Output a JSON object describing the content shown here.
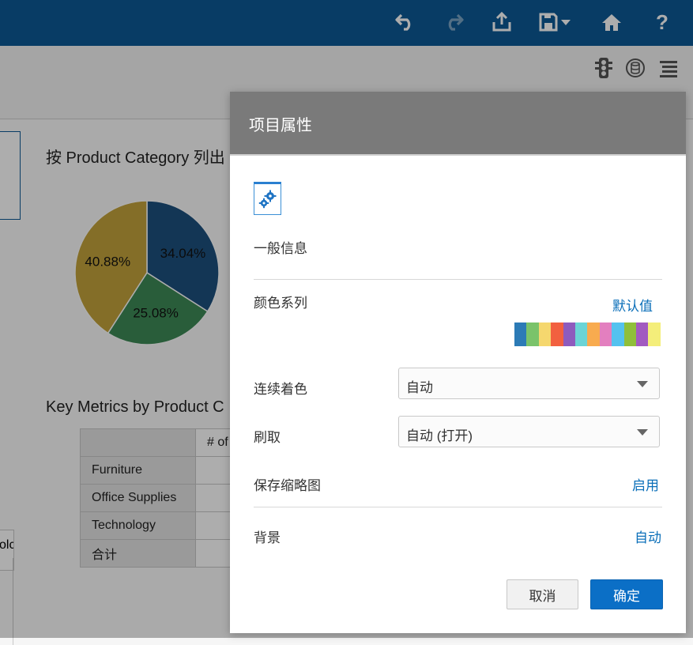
{
  "topbar": {
    "icons": [
      "undo-icon",
      "redo-icon",
      "export-icon",
      "save-icon",
      "dropdown-caret-icon",
      "home-icon",
      "help-icon"
    ],
    "help_label": "?",
    "bg_color": "#0c5996"
  },
  "toolbar": {
    "icons": [
      "traffic-light-icon",
      "database-icon",
      "menu-icon"
    ]
  },
  "canvas": {
    "pie_title": "按 Product Category 列出",
    "pie_chart": {
      "type": "pie",
      "slices": [
        {
          "label": "34.04%",
          "value": 34.04,
          "color": "#1d507e"
        },
        {
          "label": "25.08%",
          "value": 25.08,
          "color": "#3d8a56"
        },
        {
          "label": "40.88%",
          "value": 40.88,
          "color": "#c3a33b"
        }
      ]
    },
    "table_title": "Key Metrics by Product C",
    "table": {
      "header": "# of",
      "rows": [
        "Furniture",
        "Office Supplies",
        "Technology",
        "合计"
      ]
    },
    "left_fragment": "olc"
  },
  "dialog": {
    "title": "项目属性",
    "section_label": "一般信息",
    "color_series_label": "颜色系列",
    "default_link": "默认值",
    "palette": [
      "#2c7bb6",
      "#7ac36a",
      "#f5d76e",
      "#f2603f",
      "#8e5bbd",
      "#6bd4d6",
      "#f8ab4f",
      "#e37fbf",
      "#54c2ef",
      "#8fbf3a",
      "#a25ac0",
      "#f4ee7a"
    ],
    "continuous_label": "连续着色",
    "continuous_value": "自动",
    "brushing_label": "刷取",
    "brushing_value": "自动 (打开)",
    "thumbnail_label": "保存缩略图",
    "thumbnail_link": "启用",
    "background_label": "背景",
    "background_link": "自动",
    "cancel_label": "取消",
    "ok_label": "确定"
  }
}
